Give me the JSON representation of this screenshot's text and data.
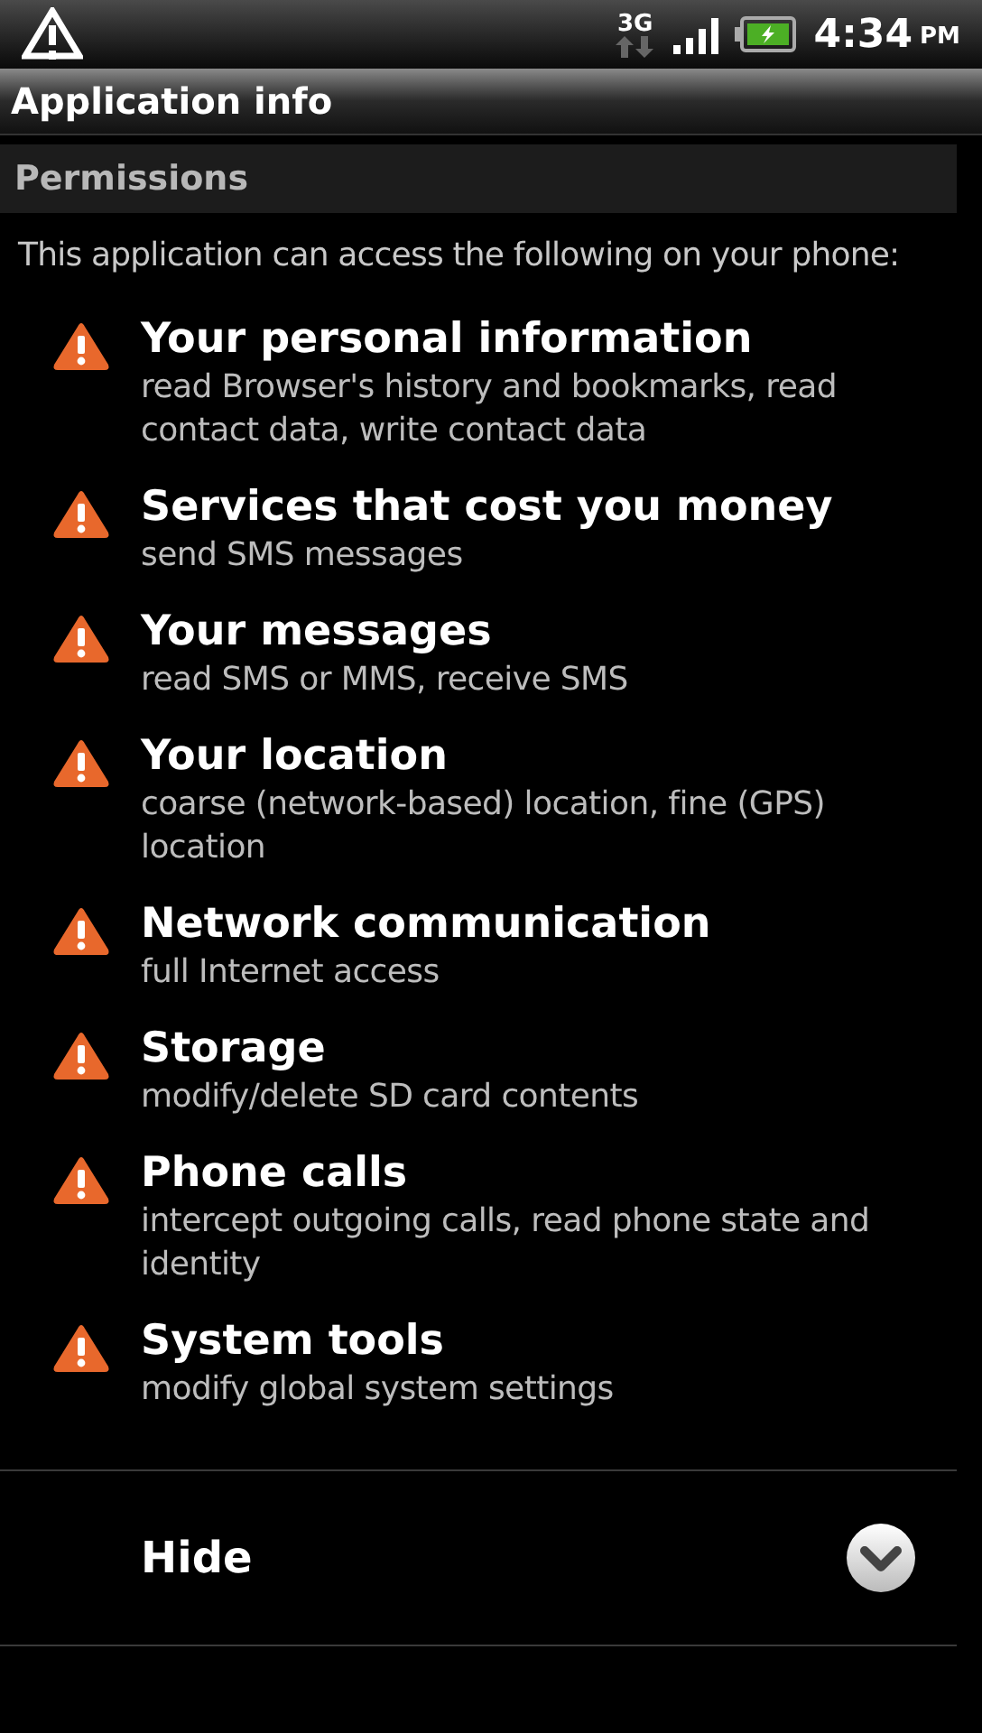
{
  "status_bar": {
    "network": "3G",
    "time": "4:34",
    "meridiem": "PM"
  },
  "window": {
    "title": "Application info"
  },
  "section": {
    "title": "Permissions"
  },
  "intro": "This application can access the following on your phone:",
  "permissions": [
    {
      "title": "Your personal information",
      "description": "read Browser's history and bookmarks, read contact data, write contact data"
    },
    {
      "title": "Services that cost you money",
      "description": "send SMS messages"
    },
    {
      "title": "Your messages",
      "description": "read SMS or MMS, receive SMS"
    },
    {
      "title": "Your location",
      "description": "coarse (network-based) location, fine (GPS) location"
    },
    {
      "title": "Network communication",
      "description": "full Internet access"
    },
    {
      "title": "Storage",
      "description": "modify/delete SD card contents"
    },
    {
      "title": "Phone calls",
      "description": "intercept outgoing calls, read phone state and identity"
    },
    {
      "title": "System tools",
      "description": "modify global system settings"
    }
  ],
  "toggle": {
    "label": "Hide",
    "expanded": true
  }
}
